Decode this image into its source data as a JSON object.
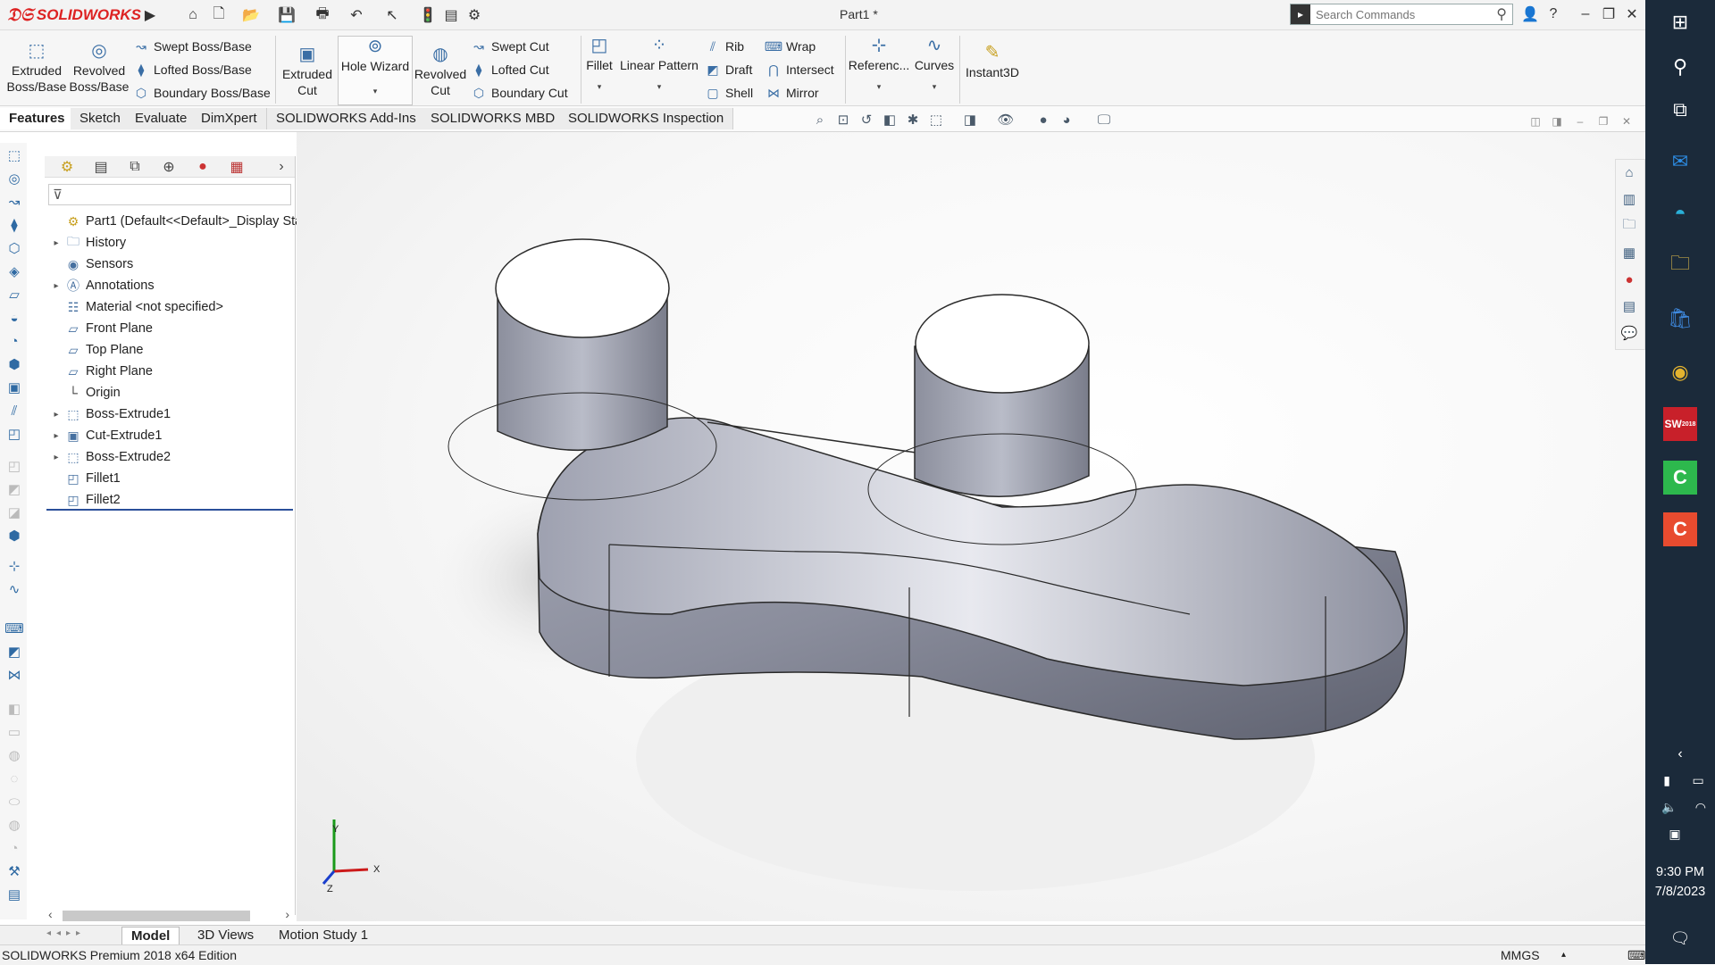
{
  "app": {
    "logo_text": "SOLIDWORKS",
    "document_title": "Part1 *"
  },
  "search": {
    "placeholder": "Search Commands"
  },
  "ribbon": {
    "extruded_boss": "Extruded Boss/Base",
    "revolved_boss": "Revolved Boss/Base",
    "swept_boss": "Swept Boss/Base",
    "lofted_boss": "Lofted Boss/Base",
    "boundary_boss": "Boundary Boss/Base",
    "extruded_cut": "Extruded Cut",
    "hole_wizard": "Hole Wizard",
    "revolved_cut": "Revolved Cut",
    "swept_cut": "Swept Cut",
    "lofted_cut": "Lofted Cut",
    "boundary_cut": "Boundary Cut",
    "fillet": "Fillet",
    "linear_pattern": "Linear Pattern",
    "rib": "Rib",
    "draft": "Draft",
    "shell": "Shell",
    "wrap": "Wrap",
    "intersect": "Intersect",
    "mirror": "Mirror",
    "reference": "Referenc...",
    "curves": "Curves",
    "instant3d": "Instant3D"
  },
  "tabs": [
    "Features",
    "Sketch",
    "Evaluate",
    "DimXpert",
    "SOLIDWORKS Add-Ins",
    "SOLIDWORKS MBD",
    "SOLIDWORKS Inspection"
  ],
  "tree": {
    "root": "Part1  (Default<<Default>_Display Sta",
    "items": [
      {
        "label": "History"
      },
      {
        "label": "Sensors"
      },
      {
        "label": "Annotations"
      },
      {
        "label": "Material <not specified>"
      },
      {
        "label": "Front Plane"
      },
      {
        "label": "Top Plane"
      },
      {
        "label": "Right Plane"
      },
      {
        "label": "Origin"
      },
      {
        "label": "Boss-Extrude1"
      },
      {
        "label": "Cut-Extrude1"
      },
      {
        "label": "Boss-Extrude2"
      },
      {
        "label": "Fillet1"
      },
      {
        "label": "Fillet2"
      }
    ]
  },
  "triad": {
    "x": "X",
    "y": "Y",
    "z": "Z"
  },
  "bottom_tabs": [
    "Model",
    "3D Views",
    "Motion Study 1"
  ],
  "status": {
    "edition": "SOLIDWORKS Premium 2018 x64 Edition",
    "units": "MMGS"
  },
  "taskbar": {
    "time": "9:30 PM",
    "date": "7/8/2023",
    "sw_badge": "SW",
    "sw_year": "2018"
  },
  "colors": {
    "brand_red": "#d22020",
    "ribbon_icon": "#3a6ea5",
    "taskbar_bg": "#1b2a3a",
    "part_body": "#8a8d9c"
  }
}
